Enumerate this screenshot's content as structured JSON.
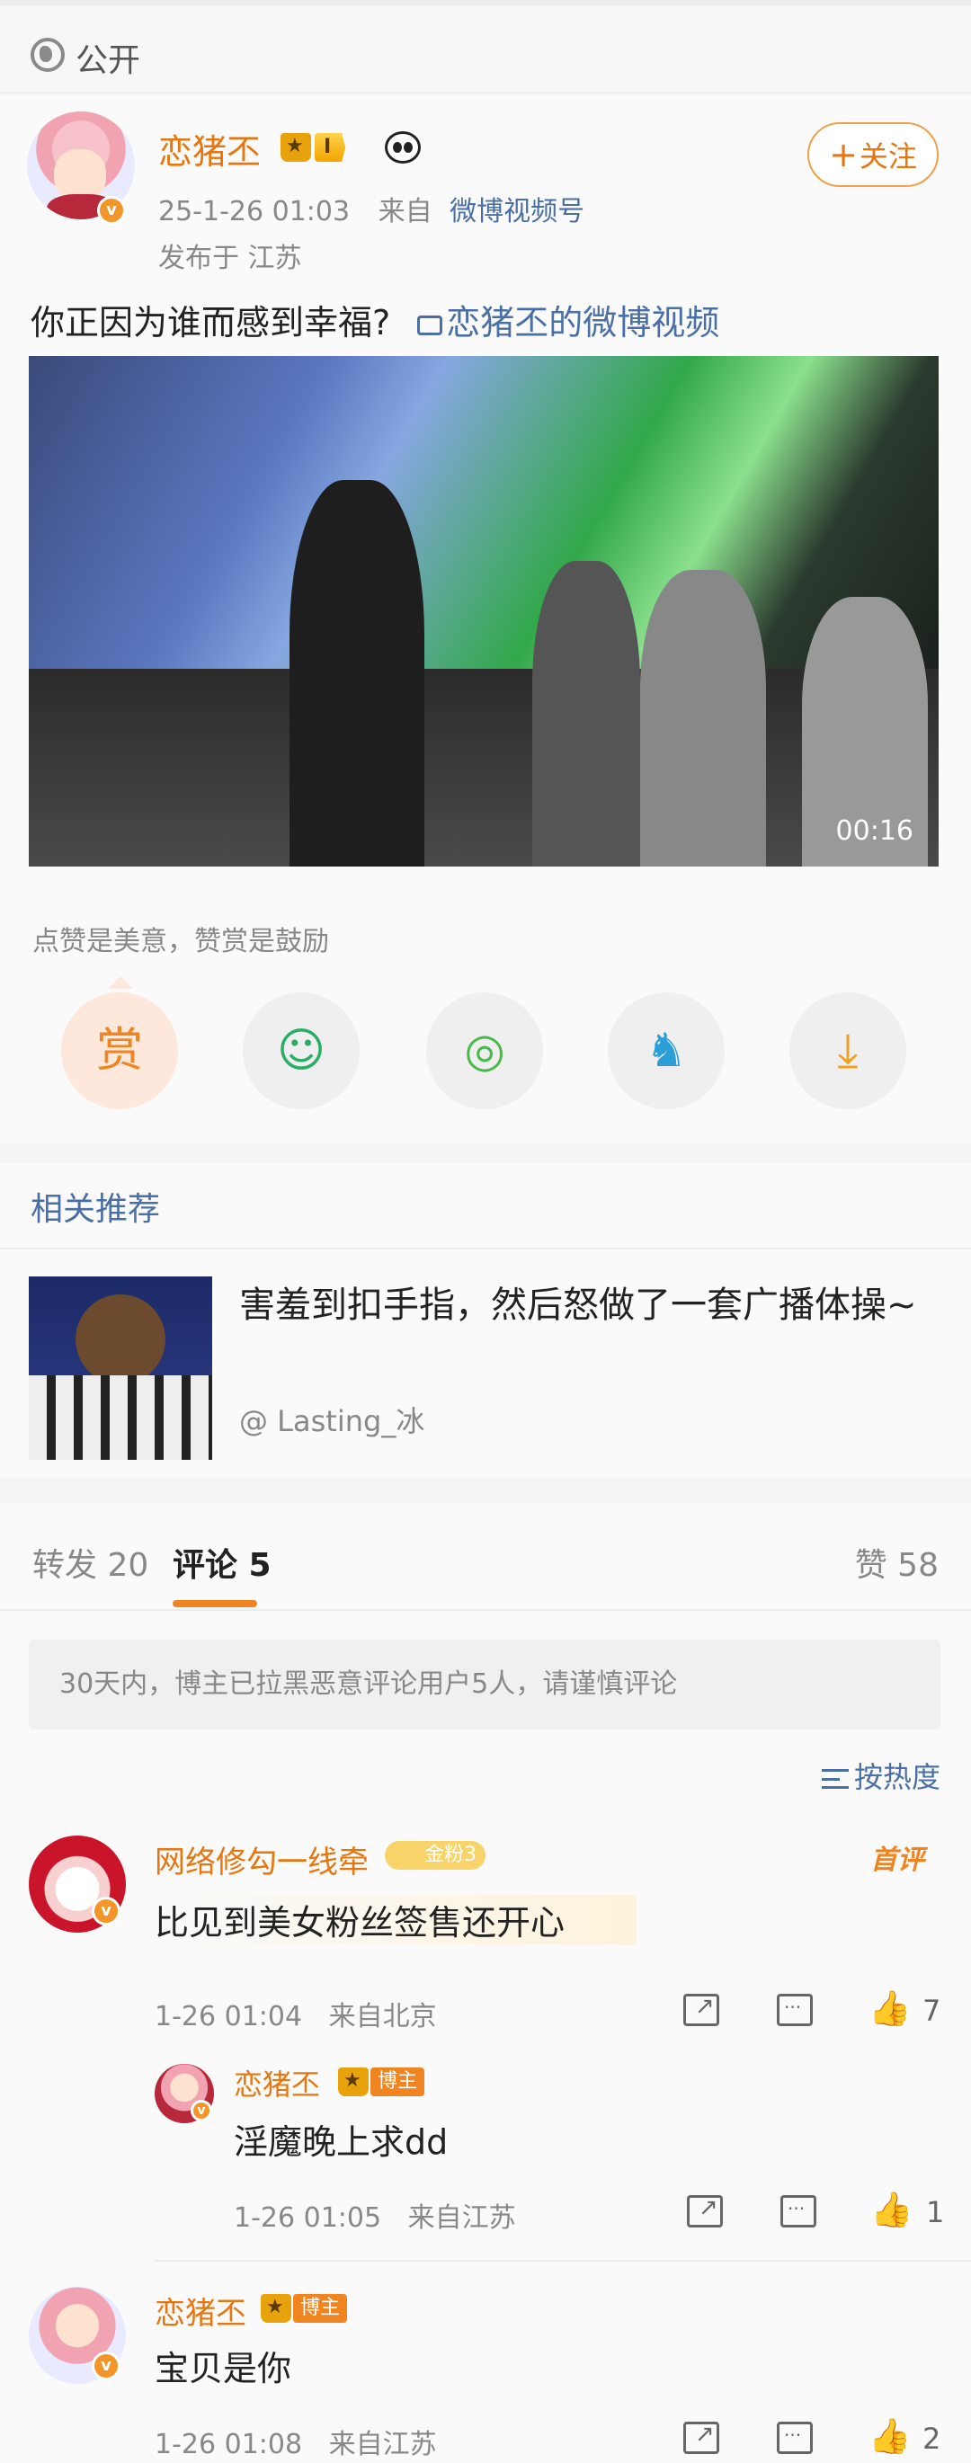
{
  "visibility": {
    "label": "公开",
    "icon": "globe-icon"
  },
  "post": {
    "author": "恋猪丕",
    "level_badge": "I",
    "timestamp": "25-1-26 01:03",
    "source_prefix": "来自",
    "source": "微博视频号",
    "location": "发布于 江苏",
    "follow_label": "关注",
    "text": "你正因为谁而感到幸福?",
    "video_link": "恋猪丕的微博视频",
    "video_duration": "00:16",
    "reward_hint": "点赞是美意，赞赏是鼓励",
    "share_buttons": [
      {
        "name": "reward",
        "glyph": "赏"
      },
      {
        "name": "wechat",
        "glyph": "☺"
      },
      {
        "name": "moments",
        "glyph": "◎"
      },
      {
        "name": "qq",
        "glyph": "♞"
      },
      {
        "name": "save-image",
        "glyph": "⤓"
      }
    ]
  },
  "related": {
    "title": "相关推荐",
    "item_text": "害羞到扣手指，然后怒做了一套广播体操~",
    "item_source": "@ Lasting_冰"
  },
  "tabs": {
    "repost": "转发 20",
    "comment": "评论 5",
    "like": "赞 58"
  },
  "notice": "30天内，博主已拉黑恶意评论用户5人，请谨慎评论",
  "sort_label": "按热度",
  "comments": [
    {
      "user": "网络修勾一线牵",
      "badge": "金粉3",
      "first_label": "首评",
      "text": "比见到美女粉丝签售还开心",
      "time": "1-26 01:04",
      "location": "来自北京",
      "likes": "7"
    },
    {
      "user": "恋猪丕",
      "badge": "博主",
      "text": "淫魔晚上求dd",
      "time": "1-26 01:05",
      "location": "来自江苏",
      "likes": "1"
    },
    {
      "user": "恋猪丕",
      "badge": "博主",
      "text": "宝贝是你",
      "time": "1-26 01:08",
      "location": "来自江苏",
      "likes": "2"
    }
  ],
  "colors": {
    "accent": "#e8760f",
    "link": "#4a6fa5",
    "reward_bg": "#fde8db"
  }
}
